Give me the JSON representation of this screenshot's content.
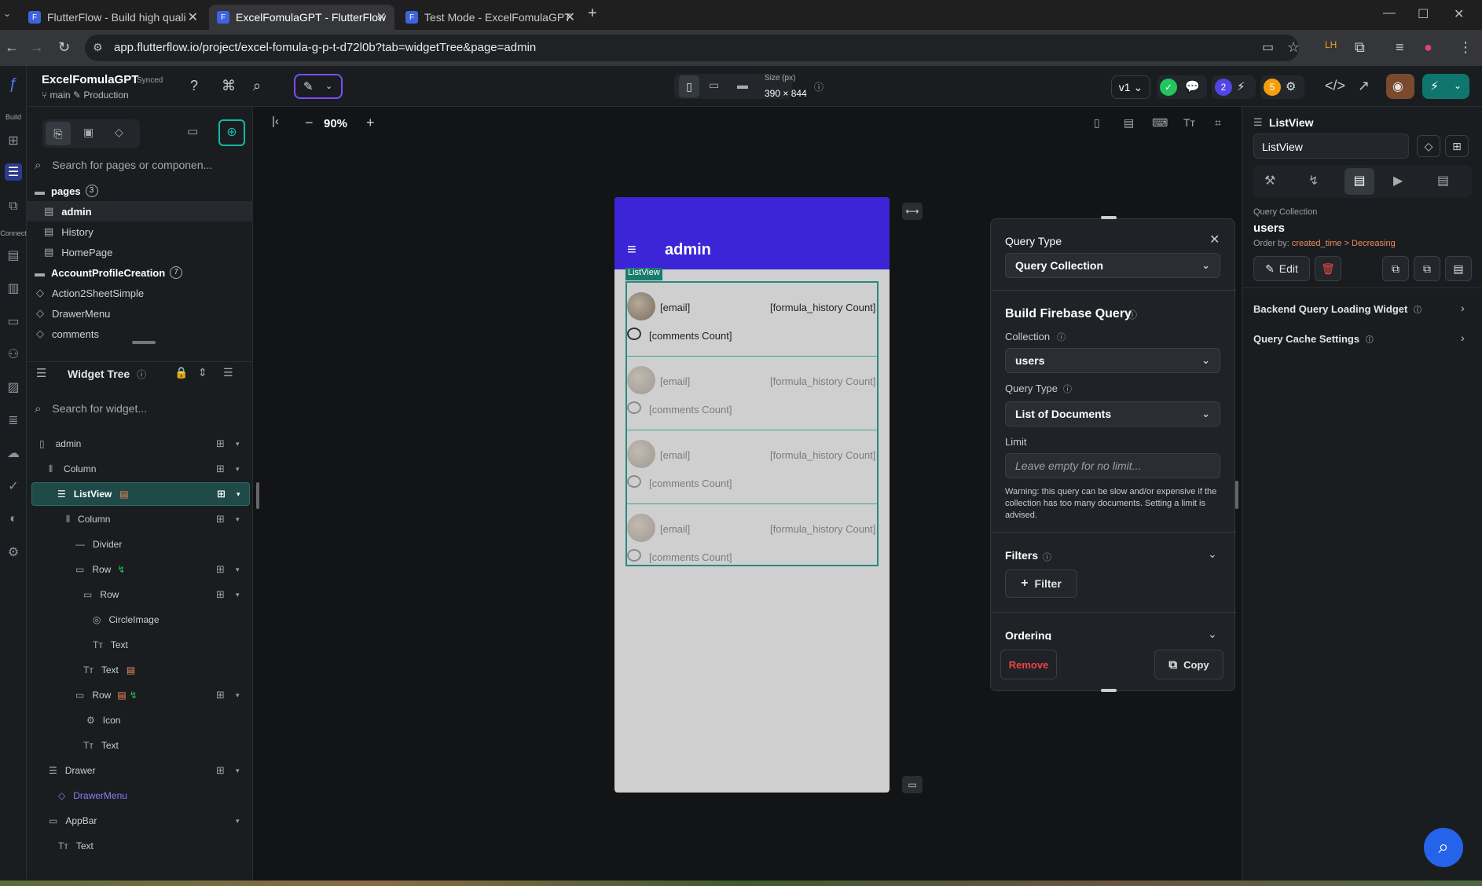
{
  "browser": {
    "tabs": [
      {
        "label": "FlutterFlow - Build high quali"
      },
      {
        "label": "ExcelFomulaGPT - FlutterFlow"
      },
      {
        "label": "Test Mode - ExcelFomulaGPT"
      }
    ],
    "url": "app.flutterflow.io/project/excel-fomula-g-p-t-d72l0b?tab=widgetTree&page=admin"
  },
  "topbar": {
    "project_name": "ExcelFomulaGPT",
    "synced": "Synced",
    "branch": "main",
    "env": "Production",
    "size_label": "Size (px)",
    "size_value": "390 × 844",
    "version": "v1",
    "badge_2": "2",
    "badge_5": "5"
  },
  "rail": {
    "build_label": "Build",
    "connect_label": "Connect"
  },
  "leftpanel": {
    "search_pages_placeholder": "Search for pages or componen...",
    "pages_label": "pages",
    "pages_count": "3",
    "pages": [
      "admin",
      "History",
      "HomePage"
    ],
    "folder_label": "AccountProfileCreation",
    "folder_count": "7",
    "components": [
      "Action2SheetSimple",
      "DrawerMenu",
      "comments"
    ],
    "widget_tree_label": "Widget Tree",
    "search_widget_placeholder": "Search for widget...",
    "tree": [
      {
        "label": "admin"
      },
      {
        "label": "Column"
      },
      {
        "label": "ListView"
      },
      {
        "label": "Column"
      },
      {
        "label": "Divider"
      },
      {
        "label": "Row"
      },
      {
        "label": "Row"
      },
      {
        "label": "CircleImage"
      },
      {
        "label": "Text"
      },
      {
        "label": "Text"
      },
      {
        "label": "Row"
      },
      {
        "label": "Icon"
      },
      {
        "label": "Text"
      },
      {
        "label": "Drawer"
      },
      {
        "label": "DrawerMenu"
      },
      {
        "label": "AppBar"
      },
      {
        "label": "Text"
      }
    ]
  },
  "canvas": {
    "zoom": "90%",
    "phone_title": "admin",
    "listview_tag": "ListView",
    "items": [
      {
        "email": "[email]",
        "count": "[formula_history Count]",
        "comments": "[comments Count]"
      },
      {
        "email": "[email]",
        "count": "[formula_history Count]",
        "comments": "[comments Count]"
      },
      {
        "email": "[email]",
        "count": "[formula_history Count]",
        "comments": "[comments Count]"
      },
      {
        "email": "[email]",
        "count": "[formula_history Count]",
        "comments": "[comments Count]"
      }
    ]
  },
  "query_panel": {
    "query_type_label": "Query Type",
    "query_type_value": "Query Collection",
    "build_heading": "Build Firebase Query",
    "collection_label": "Collection",
    "collection_value": "users",
    "query_type2_label": "Query Type",
    "query_type2_value": "List of Documents",
    "limit_label": "Limit",
    "limit_placeholder": "Leave empty for no limit...",
    "warning": "Warning: this query can be slow and/or expensive if the collection has too many documents. Setting a limit is advised.",
    "filters_label": "Filters",
    "filter_button": "Filter",
    "ordering_label": "Ordering",
    "remove_button": "Remove",
    "copy_button": "Copy"
  },
  "right_panel": {
    "widget_label": "ListView",
    "widget_name": "ListView",
    "query_collection_label": "Query Collection",
    "collection": "users",
    "order_prefix": "Order by:",
    "order_value": "created_time > Decreasing",
    "edit_button": "Edit",
    "backend_loading": "Backend Query Loading Widget",
    "cache_settings": "Query Cache Settings"
  }
}
